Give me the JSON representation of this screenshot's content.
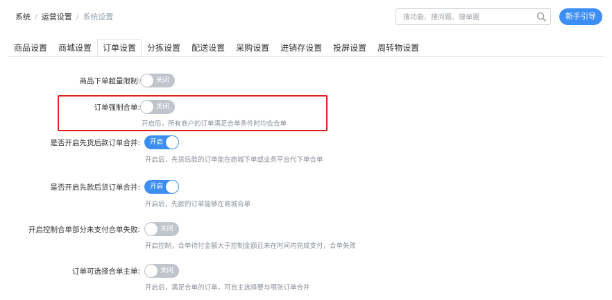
{
  "breadcrumb": {
    "items": [
      "系统",
      "运营设置"
    ],
    "separator": "/",
    "current": "系统设置"
  },
  "search": {
    "placeholder": "搜功能、搜问题、搜单据",
    "icon": "search-icon"
  },
  "guide_button": {
    "label": "新手引导"
  },
  "tabs": [
    {
      "label": "商品设置",
      "active": false
    },
    {
      "label": "商城设置",
      "active": false
    },
    {
      "label": "订单设置",
      "active": true
    },
    {
      "label": "分拣设置",
      "active": false
    },
    {
      "label": "配送设置",
      "active": false
    },
    {
      "label": "采购设置",
      "active": false
    },
    {
      "label": "进销存设置",
      "active": false
    },
    {
      "label": "投屏设置",
      "active": false
    },
    {
      "label": "周转物设置",
      "active": false
    }
  ],
  "settings": [
    {
      "label": "商品下单超量限制:",
      "state": "off",
      "toggle_text": "关闭",
      "hint": ""
    },
    {
      "label": "订单强制合单:",
      "state": "off",
      "toggle_text": "关闭",
      "hint": "开启后，所有商户的订单满足合单条件时均会合单"
    },
    {
      "label": "是否开启先货后款订单合并:",
      "state": "on",
      "toggle_text": "开启",
      "hint": "开启后，先货后款的订单能在商城下单或业务平台代下单合单"
    },
    {
      "label": "是否开启先款后货订单合并:",
      "state": "on",
      "toggle_text": "开启",
      "hint": "开启后，先款的订单能够在商城合单"
    },
    {
      "label": "开启控制合单部分未支付合单失败:",
      "state": "off",
      "toggle_text": "关闭",
      "hint": "开启控制，合单待付金额大于控制金额且未在时间内完成支付，合单失败"
    },
    {
      "label": "订单可选择合单主单:",
      "state": "off",
      "toggle_text": "关闭",
      "hint": "开启后，满足合单的订单，可自主选择要与哪张订单合并"
    }
  ],
  "colors": {
    "accent": "#3d8ef3",
    "toggle_off": "#c0c4cc",
    "highlight": "#e2211c"
  }
}
